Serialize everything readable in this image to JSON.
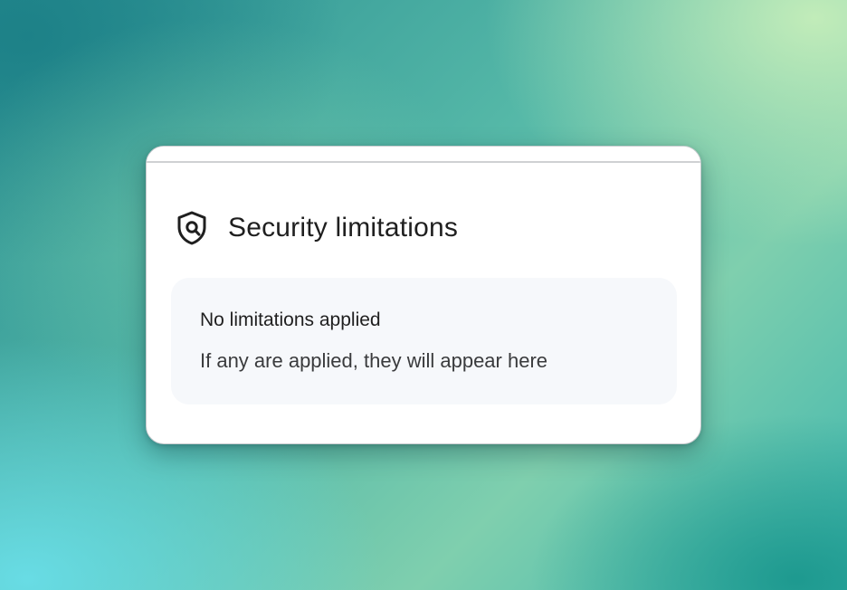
{
  "panel": {
    "title": "Security limitations",
    "icon": "shield-search-icon",
    "status": {
      "heading": "No limitations applied",
      "description": "If any are applied, they will appear here"
    }
  },
  "colors": {
    "card_background": "#ffffff",
    "info_box_background": "#f6f8fb",
    "text_primary": "#1f1f1f",
    "text_secondary": "#3a3b3d"
  }
}
